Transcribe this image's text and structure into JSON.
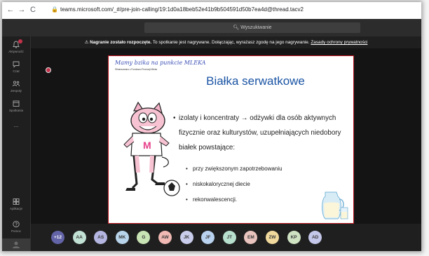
{
  "browser": {
    "back": "←",
    "forward": "→",
    "reload": "C",
    "url": "teams.microsoft.com/_#/pre-join-calling/19:1d0a18beb52e41b9b504591d50b7ea4d@thread.tacv2"
  },
  "header": {
    "search_placeholder": "Wyszukiwanie"
  },
  "rail": {
    "items": [
      {
        "label": "Aktywność"
      },
      {
        "label": "Czat"
      },
      {
        "label": "Zespoły"
      },
      {
        "label": "Spotkania"
      },
      {
        "label": "..."
      },
      {
        "label": "Aplikacje"
      },
      {
        "label": "Pomoc"
      }
    ]
  },
  "notice": {
    "bold": "Nagranie zostało rozpoczęte.",
    "text": " To spotkanie jest nagrywane. Dołączając, wyrażasz zgodę na jego nagrywanie. ",
    "link": "Zasady ochrony prywatności"
  },
  "slide": {
    "brand": "Mamy bzika na punkcie MLEKA",
    "brand_sub": "Sfinansowano z Funduszu Promocji Mleka",
    "title": "Białka serwatkowe",
    "main_bullet": "izolaty i koncentraty → odżywki dla osób aktywnych fizycznie oraz kulturystów, uzupełniających niedobory białek powstające:",
    "sub_bullets": [
      "przy zwiększonym zapotrzebowaniu",
      "niskokalorycznej diecie",
      "rekonwalescencji."
    ]
  },
  "participants": [
    {
      "initials": "+12",
      "color": "#6264a7"
    },
    {
      "initials": "AA",
      "color": "#c1e1d4"
    },
    {
      "initials": "AS",
      "color": "#b4b5e0"
    },
    {
      "initials": "MK",
      "color": "#b8d4ea"
    },
    {
      "initials": "G",
      "color": "#c8e3b4"
    },
    {
      "initials": "AW",
      "color": "#f0b9b3"
    },
    {
      "initials": "JK",
      "color": "#c9cceb"
    },
    {
      "initials": "JF",
      "color": "#b9d2ef"
    },
    {
      "initials": "JT",
      "color": "#b7dfcd"
    },
    {
      "initials": "EM",
      "color": "#e9c3bd"
    },
    {
      "initials": "ZW",
      "color": "#f1d99d"
    },
    {
      "initials": "KP",
      "color": "#cfe3c3"
    },
    {
      "initials": "AD",
      "color": "#c5c7ea"
    }
  ]
}
